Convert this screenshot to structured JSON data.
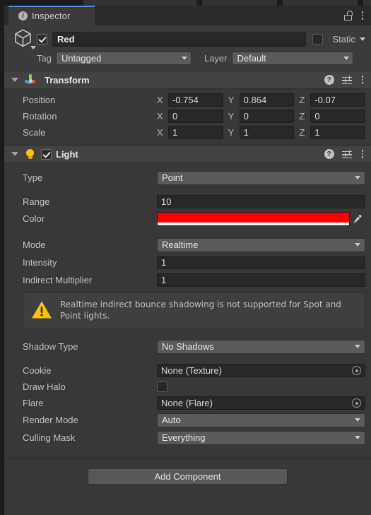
{
  "window": {
    "tab_label": "Inspector",
    "info_icon": "info-icon",
    "lock_icon": "lock-open-icon",
    "menu_icon": "kebab-menu-icon",
    "accent_color": "#4f8fd4"
  },
  "gameobject": {
    "icon": "cube-icon",
    "enabled": true,
    "name": "Red",
    "static_label": "Static",
    "static_checked": false,
    "tag_label": "Tag",
    "tag_value": "Untagged",
    "layer_label": "Layer",
    "layer_value": "Default"
  },
  "transform": {
    "title": "Transform",
    "icon": "transform-gizmo-icon",
    "expanded": true,
    "axes": [
      "X",
      "Y",
      "Z"
    ],
    "rows": [
      {
        "label": "Position",
        "values": [
          "-0.754",
          "0.864",
          "-0.07"
        ]
      },
      {
        "label": "Rotation",
        "values": [
          "0",
          "0",
          "0"
        ]
      },
      {
        "label": "Scale",
        "values": [
          "1",
          "1",
          "1"
        ]
      }
    ]
  },
  "light": {
    "title": "Light",
    "icon": "light-bulb-icon",
    "expanded": true,
    "enabled": true,
    "type": {
      "label": "Type",
      "value": "Point"
    },
    "range": {
      "label": "Range",
      "value": "10"
    },
    "color": {
      "label": "Color",
      "value": "#FF0000",
      "alpha_color": "#FFFFFF",
      "eyedropper_icon": "eyedropper-icon"
    },
    "mode": {
      "label": "Mode",
      "value": "Realtime"
    },
    "intensity": {
      "label": "Intensity",
      "value": "1"
    },
    "indirect_multiplier": {
      "label": "Indirect Multiplier",
      "value": "1"
    },
    "warning": {
      "icon": "warning-triangle-icon",
      "color": "#FFC107",
      "text": "Realtime indirect bounce shadowing is not supported for Spot and Point lights."
    },
    "shadow_type": {
      "label": "Shadow Type",
      "value": "No Shadows"
    },
    "cookie": {
      "label": "Cookie",
      "value": "None (Texture)",
      "picker_icon": "object-picker-icon"
    },
    "draw_halo": {
      "label": "Draw Halo",
      "checked": false
    },
    "flare": {
      "label": "Flare",
      "value": "None (Flare)",
      "picker_icon": "object-picker-icon"
    },
    "render_mode": {
      "label": "Render Mode",
      "value": "Auto"
    },
    "culling_mask": {
      "label": "Culling Mask",
      "value": "Everything"
    }
  },
  "footer": {
    "add_component_label": "Add Component"
  }
}
